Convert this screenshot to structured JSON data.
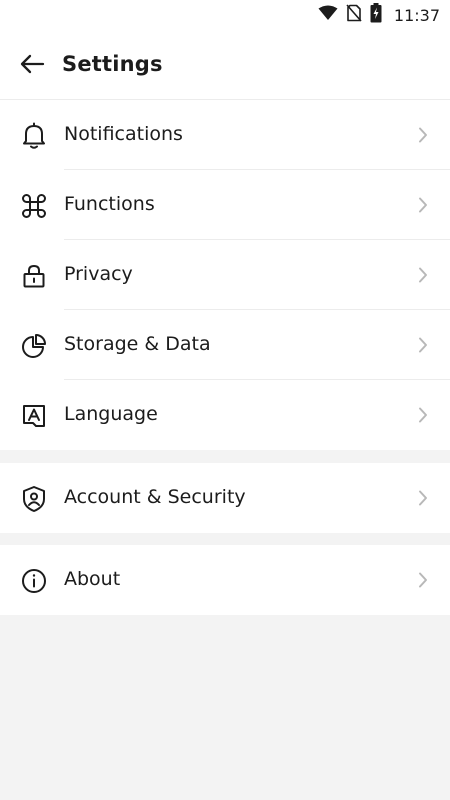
{
  "status_bar": {
    "time": "11:37",
    "icons": [
      "wifi-icon",
      "no-sim-icon",
      "battery-charging-icon"
    ]
  },
  "header": {
    "back_icon": "arrow-left-icon",
    "title": "Settings"
  },
  "groups": [
    {
      "items": [
        {
          "label": "Notifications",
          "icon": "bell-icon"
        },
        {
          "label": "Functions",
          "icon": "command-icon"
        },
        {
          "label": "Privacy",
          "icon": "lock-icon"
        },
        {
          "label": "Storage & Data",
          "icon": "pie-chart-icon"
        },
        {
          "label": "Language",
          "icon": "language-icon"
        }
      ]
    },
    {
      "items": [
        {
          "label": "Account & Security",
          "icon": "shield-user-icon"
        }
      ]
    },
    {
      "items": [
        {
          "label": "About",
          "icon": "info-icon"
        }
      ]
    }
  ],
  "colors": {
    "background": "#f3f3f3",
    "surface": "#ffffff",
    "text": "#1c1c1c",
    "chevron": "#b8b8b8",
    "divider": "#ececec"
  }
}
